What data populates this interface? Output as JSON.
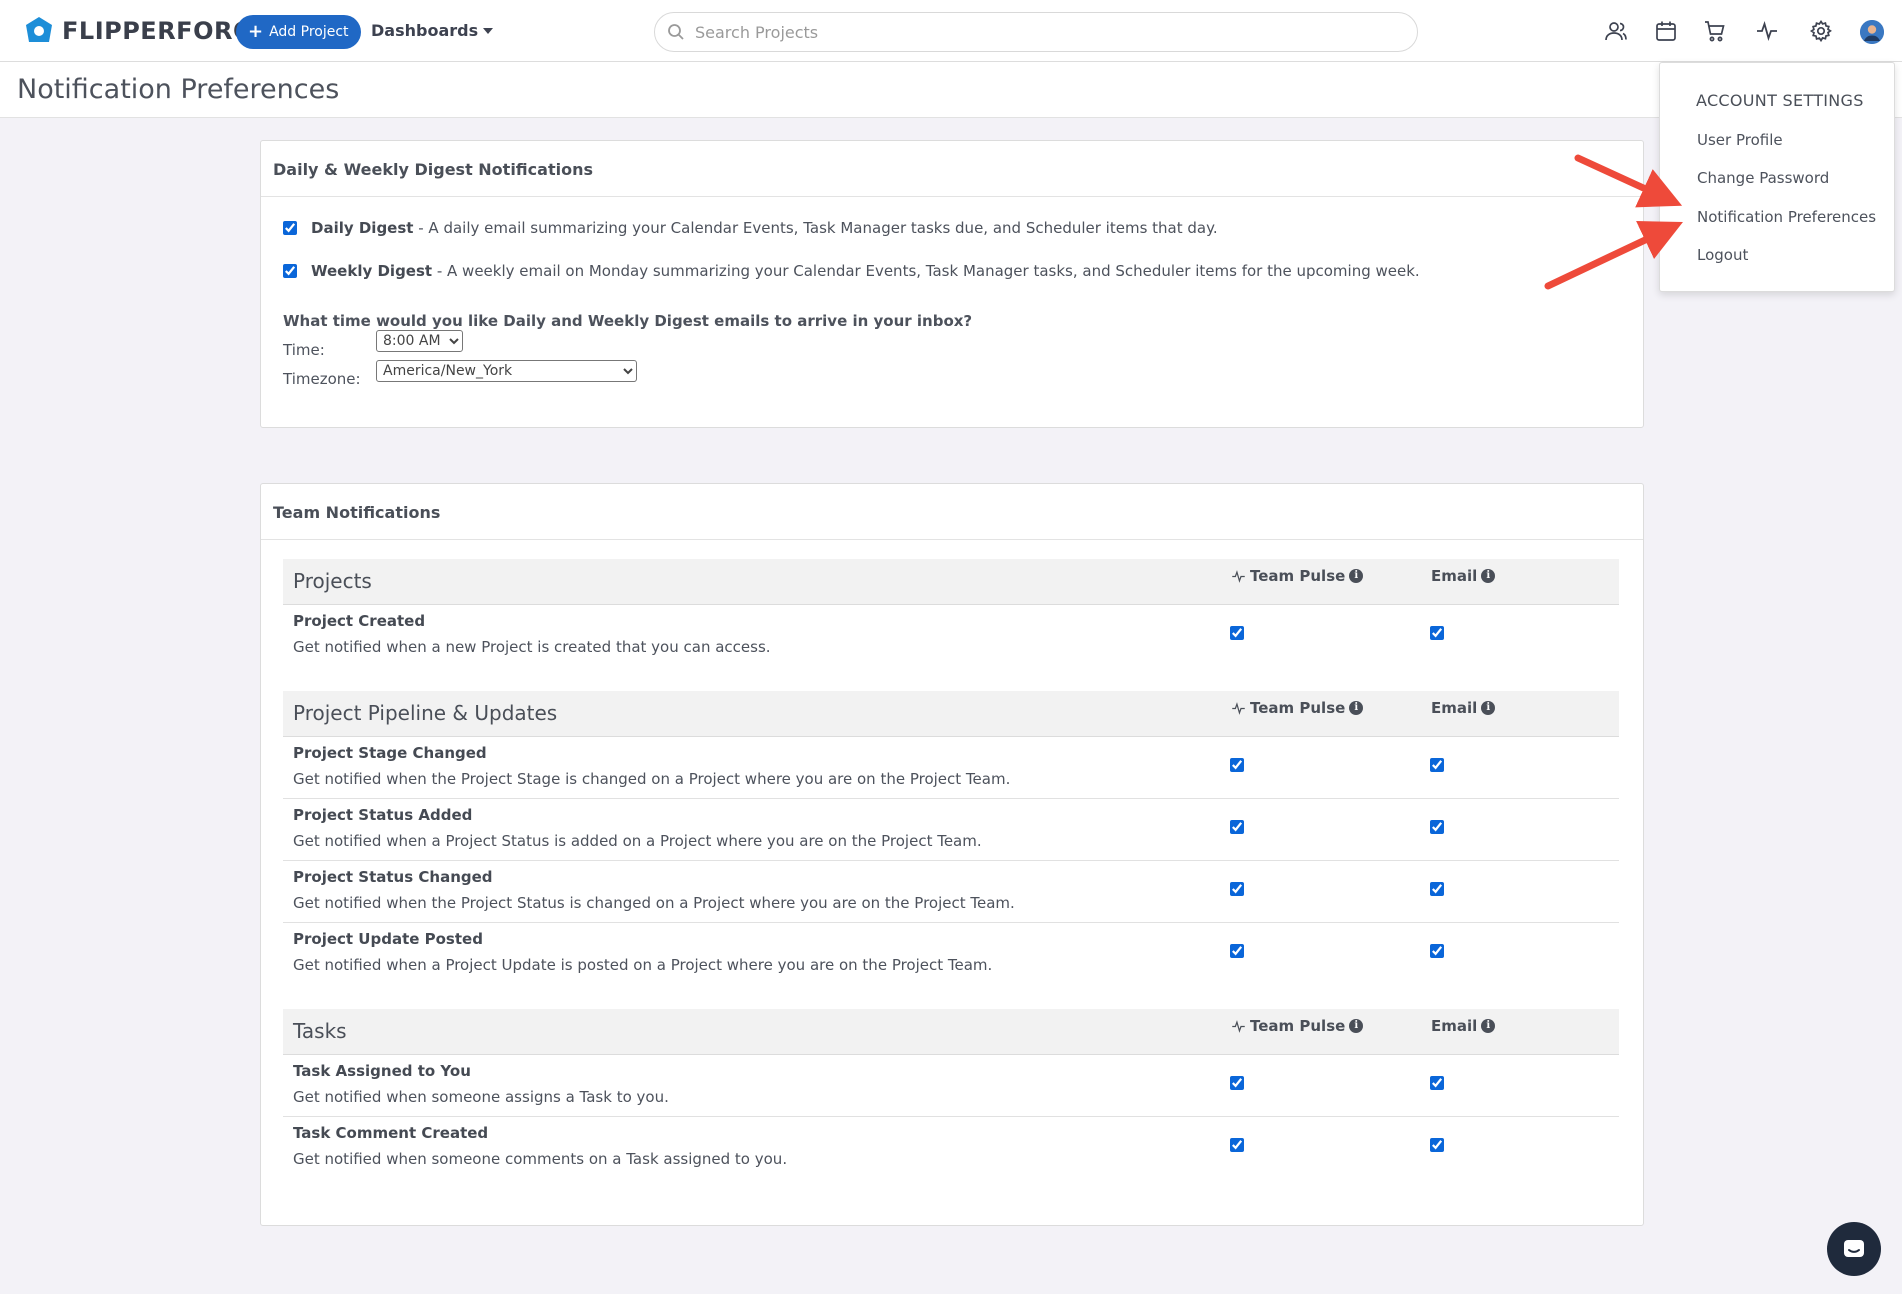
{
  "app": {
    "logo_text": "FLIPPERFORCE",
    "add_project_label": "Add Project",
    "dashboards_label": "Dashboards",
    "search_placeholder": "Search Projects",
    "icons": [
      "team-icon",
      "calendar-icon",
      "cart-icon",
      "pulse-icon",
      "settings-icon",
      "avatar"
    ],
    "accent_color": "#2068c5"
  },
  "page": {
    "title": "Notification Preferences"
  },
  "account_menu": {
    "header": "ACCOUNT SETTINGS",
    "items": [
      "User Profile",
      "Change Password",
      "Notification Preferences",
      "Logout"
    ]
  },
  "digest": {
    "heading": "Daily & Weekly Digest Notifications",
    "daily": {
      "label": "Daily Digest",
      "desc": " - A daily email summarizing your Calendar Events, Task Manager tasks due, and Scheduler items that day.",
      "checked": true
    },
    "weekly": {
      "label": "Weekly Digest",
      "desc": " - A weekly email on Monday summarizing your Calendar Events, Task Manager tasks, and Scheduler items for the upcoming week.",
      "checked": true
    },
    "question": "What time would you like Daily and Weekly Digest emails to arrive in your inbox?",
    "time_label": "Time:",
    "time_value": "8:00 AM",
    "timezone_label": "Timezone:",
    "timezone_value": "America/New_York"
  },
  "team": {
    "heading": "Team Notifications",
    "col_pulse": "Team Pulse",
    "col_email": "Email",
    "sections": [
      {
        "title": "Projects",
        "rows": [
          {
            "title": "Project Created",
            "desc": "Get notified when a new Project is created that you can access.",
            "pulse": true,
            "email": true
          }
        ]
      },
      {
        "title": "Project Pipeline & Updates",
        "rows": [
          {
            "title": "Project Stage Changed",
            "desc": "Get notified when the Project Stage is changed on a Project where you are on the Project Team.",
            "pulse": true,
            "email": true
          },
          {
            "title": "Project Status Added",
            "desc": "Get notified when a Project Status is added on a Project where you are on the Project Team.",
            "pulse": true,
            "email": true
          },
          {
            "title": "Project Status Changed",
            "desc": "Get notified when the Project Status is changed on a Project where you are on the Project Team.",
            "pulse": true,
            "email": true
          },
          {
            "title": "Project Update Posted",
            "desc": "Get notified when a Project Update is posted on a Project where you are on the Project Team.",
            "pulse": true,
            "email": true
          }
        ]
      },
      {
        "title": "Tasks",
        "rows": [
          {
            "title": "Task Assigned to You",
            "desc": "Get notified when someone assigns a Task to you.",
            "pulse": true,
            "email": true
          },
          {
            "title": "Task Comment Created",
            "desc": "Get notified when someone comments on a Task assigned to you.",
            "pulse": true,
            "email": true
          }
        ]
      }
    ]
  }
}
